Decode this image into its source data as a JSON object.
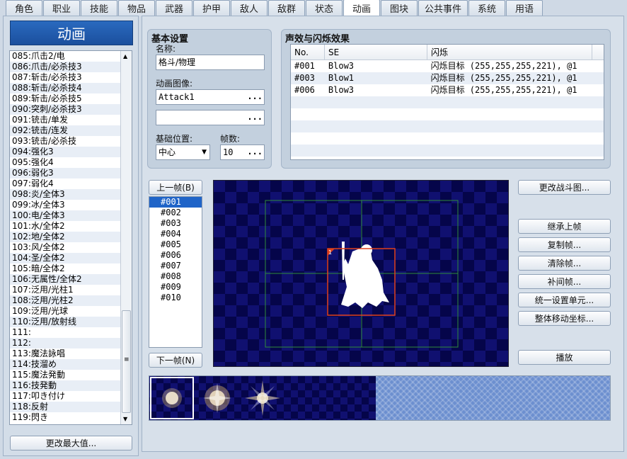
{
  "tabs": [
    {
      "label": "角色"
    },
    {
      "label": "职业"
    },
    {
      "label": "技能"
    },
    {
      "label": "物品"
    },
    {
      "label": "武器"
    },
    {
      "label": "护甲"
    },
    {
      "label": "敌人"
    },
    {
      "label": "敌群"
    },
    {
      "label": "状态"
    },
    {
      "label": "动画"
    },
    {
      "label": "图块"
    },
    {
      "label": "公共事件"
    },
    {
      "label": "系统"
    },
    {
      "label": "用语"
    }
  ],
  "active_tab": "动画",
  "list_title": "动画",
  "animations": [
    {
      "label": "085:爪击2/电"
    },
    {
      "label": "086:爪击/必杀技3"
    },
    {
      "label": "087:斩击/必杀技3"
    },
    {
      "label": "088:斩击/必杀技4"
    },
    {
      "label": "089:斩击/必杀技5"
    },
    {
      "label": "090:突刺/必杀技3"
    },
    {
      "label": "091:铳击/单发"
    },
    {
      "label": "092:铳击/连发"
    },
    {
      "label": "093:铳击/必杀技"
    },
    {
      "label": "094:强化3"
    },
    {
      "label": "095:强化4"
    },
    {
      "label": "096:弱化3"
    },
    {
      "label": "097:弱化4"
    },
    {
      "label": "098:炎/全体3"
    },
    {
      "label": "099:冰/全体3"
    },
    {
      "label": "100:电/全体3"
    },
    {
      "label": "101:水/全体2"
    },
    {
      "label": "102:地/全体2"
    },
    {
      "label": "103:风/全体2"
    },
    {
      "label": "104:圣/全体2"
    },
    {
      "label": "105:暗/全体2"
    },
    {
      "label": "106:无属性/全体2"
    },
    {
      "label": "107:泛用/光柱1"
    },
    {
      "label": "108:泛用/光柱2"
    },
    {
      "label": "109:泛用/光球"
    },
    {
      "label": "110:泛用/放射线"
    },
    {
      "label": "111:"
    },
    {
      "label": "112:"
    },
    {
      "label": "113:魔法詠唱"
    },
    {
      "label": "114:技溜め"
    },
    {
      "label": "115:魔法発動"
    },
    {
      "label": "116:技発動"
    },
    {
      "label": "117:叩き付け"
    },
    {
      "label": "118:反射"
    },
    {
      "label": "119:閃き"
    }
  ],
  "change_max_button": "更改最大值...",
  "basic": {
    "title": "基本设置",
    "name_label": "名称:",
    "name_value": "格斗/物理",
    "image_label": "动画图像:",
    "image1": "Attack1",
    "image2": "",
    "dots": "...",
    "position_label": "基础位置:",
    "position_value": "中心",
    "frames_label": "帧数:",
    "frames_value": "10"
  },
  "se": {
    "title": "声效与闪烁效果",
    "headers": {
      "no": "No.",
      "se": "SE",
      "flash": "闪烁"
    },
    "rows": [
      {
        "no": "#001",
        "se": "Blow3",
        "flash": "闪烁目标 (255,255,255,221), @1"
      },
      {
        "no": "#003",
        "se": "Blow1",
        "flash": "闪烁目标 (255,255,255,221), @1"
      },
      {
        "no": "#006",
        "se": "Blow3",
        "flash": "闪烁目标 (255,255,255,221), @1"
      }
    ]
  },
  "prev_frame": "上一帧(B)",
  "next_frame": "下一帧(N)",
  "frames": [
    "#001",
    "#002",
    "#003",
    "#004",
    "#005",
    "#006",
    "#007",
    "#008",
    "#009",
    "#010"
  ],
  "selected_frame": "#001",
  "cell_number": "1",
  "buttons": {
    "change_battler": "更改战斗图...",
    "inherit_prev": "继承上帧",
    "copy_frame": "复制帧...",
    "clear_frame": "清除帧...",
    "tween": "补间帧...",
    "batch_cell": "统一设置单元...",
    "shift_all": "整体移动坐标...",
    "play": "播放"
  },
  "colors": {
    "accent": "#1f64c8",
    "canvas_dark": "#05054a",
    "canvas_light": "#101070",
    "cell_border": "#e0401a",
    "grid": "#2e8b3a"
  }
}
